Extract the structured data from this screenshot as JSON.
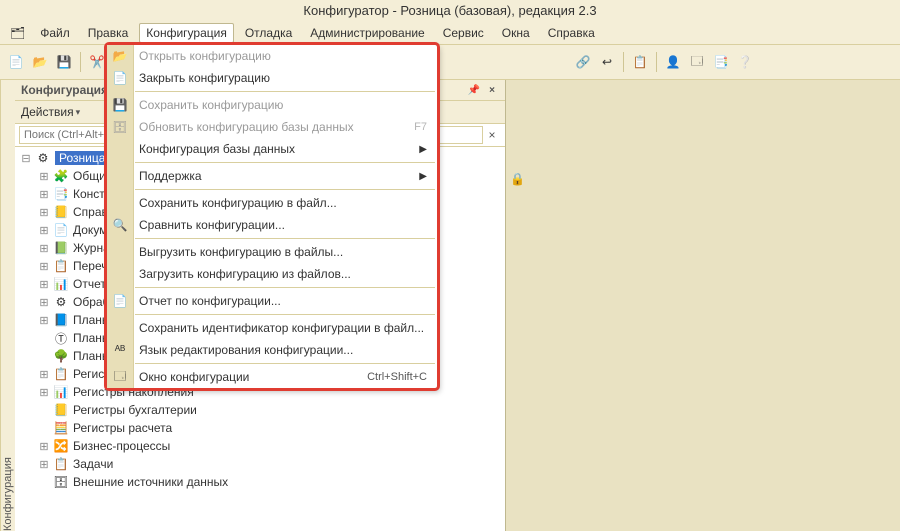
{
  "window": {
    "title": "Конфигуратор - Розница (базовая), редакция 2.3"
  },
  "menubar": {
    "file": "Файл",
    "edit": "Правка",
    "config": "Конфигурация",
    "debug": "Отладка",
    "admin": "Администрирование",
    "service": "Сервис",
    "windows": "Окна",
    "help": "Справка"
  },
  "panel": {
    "title": "Конфигурация",
    "actions": "Действия",
    "search_placeholder": "Поиск (Ctrl+Alt+M)"
  },
  "sideTab": "Конфигурация",
  "tree": {
    "root": "РозницаБазовая",
    "items": [
      "Общие",
      "Константы",
      "Справочники",
      "Документы",
      "Журналы документов",
      "Перечисления",
      "Отчеты",
      "Обработки",
      "Планы видов характеристик",
      "Планы счетов",
      "Планы видов расчета",
      "Регистры сведений",
      "Регистры накопления",
      "Регистры бухгалтерии",
      "Регистры расчета",
      "Бизнес-процессы",
      "Задачи",
      "Внешние источники данных"
    ]
  },
  "dropdown": {
    "open": "Открыть конфигурацию",
    "close": "Закрыть конфигурацию",
    "save": "Сохранить конфигурацию",
    "updateDb": "Обновить конфигурацию базы данных",
    "updateDbKey": "F7",
    "dbConfig": "Конфигурация базы данных",
    "support": "Поддержка",
    "saveToFile": "Сохранить конфигурацию в файл...",
    "compare": "Сравнить конфигурации...",
    "exportFiles": "Выгрузить конфигурацию в файлы...",
    "importFiles": "Загрузить конфигурацию из файлов...",
    "report": "Отчет по конфигурации...",
    "saveId": "Сохранить идентификатор конфигурации в файл...",
    "editLang": "Язык редактирования конфигурации...",
    "configWindow": "Окно конфигурации",
    "configWindowKey": "Ctrl+Shift+C"
  },
  "icons": {
    "doc": "📄",
    "open": "📂",
    "save": "💾",
    "copy": "📋",
    "search": "🔍",
    "folder": "📁",
    "db": "🗄",
    "action": "⚙",
    "user": "👤",
    "help": "❔",
    "lock": "🔒",
    "tree": "🌳",
    "book": "📘",
    "book2": "📗",
    "list": "📋",
    "chart": "📊",
    "abc": "ᴬᴮ",
    "window": "🗔",
    "close": "×",
    "pin": "📌"
  }
}
